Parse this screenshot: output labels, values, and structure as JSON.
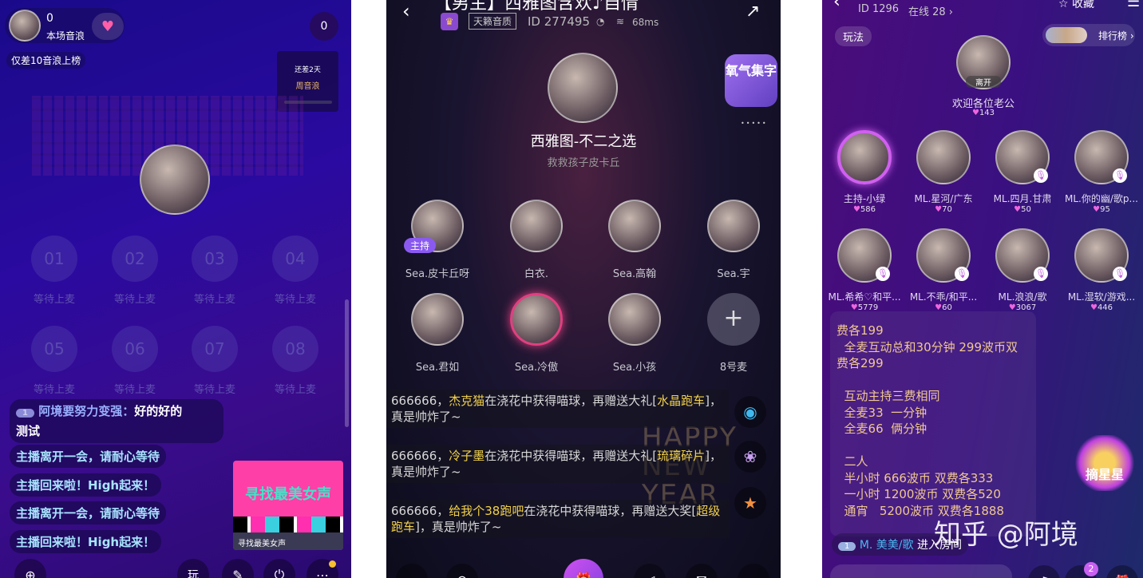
{
  "left": {
    "score": "0",
    "score_label": "本场音浪",
    "rank_hint": "仅差10音浪上榜",
    "right_count": "0",
    "weekly": {
      "days": "还差2天",
      "label": "周音浪"
    },
    "seats": [
      {
        "num": "01",
        "label": "等待上麦"
      },
      {
        "num": "02",
        "label": "等待上麦"
      },
      {
        "num": "03",
        "label": "等待上麦"
      },
      {
        "num": "04",
        "label": "等待上麦"
      },
      {
        "num": "05",
        "label": "等待上麦"
      },
      {
        "num": "06",
        "label": "等待上麦"
      },
      {
        "num": "07",
        "label": "等待上麦"
      },
      {
        "num": "08",
        "label": "等待上麦"
      }
    ],
    "chat": [
      {
        "badge": "1",
        "user": "阿境要努力变强：",
        "text": "好的好的",
        "text2": "测试"
      },
      {
        "text": "主播离开一会，请耐心等待"
      },
      {
        "text": "主播回来啦！High起来！"
      },
      {
        "text": "主播离开一会，请耐心等待"
      },
      {
        "text": "主播回来啦！High起来！"
      }
    ],
    "promo": {
      "banner": "寻找最美女声",
      "caption": "寻找最美女声"
    }
  },
  "middle": {
    "title": "【男主】西雅图含欢♪自情",
    "quality": "天籁音质",
    "room_id": "ID 277495",
    "ping": "68ms",
    "host_name": "西雅图-不二之选",
    "host_sub": "救救孩子皮卡丘",
    "side_badge": "氧气集字",
    "host_tag": "主持",
    "seats": [
      {
        "name": "Sea.皮卡丘呀"
      },
      {
        "name": "白衣."
      },
      {
        "name": "Sea.高翰"
      },
      {
        "name": "Sea.宇"
      },
      {
        "name": "Sea.君如"
      },
      {
        "name": "Sea.冷傲"
      },
      {
        "name": "Sea.小孩"
      },
      {
        "name": "8号麦"
      }
    ],
    "messages": [
      {
        "a": "666666，",
        "b": "杰克猫",
        "c": "在浇花中获得喵球，再赠送大礼[",
        "d": "水晶跑车",
        "e": "]，真是帅炸了~"
      },
      {
        "a": "666666，",
        "b": "冷子墨",
        "c": "在浇花中获得喵球，再赠送大礼[",
        "d": "琉璃碎片",
        "e": "]，真是帅炸了~"
      },
      {
        "a": "666666，",
        "b": "给我个38跑吧",
        "c": "在浇花中获得喵球，再赠送大奖[",
        "d": "超级跑车",
        "e": "]，真是帅炸了~"
      }
    ],
    "bg_text": "HAPPY NEW YEAR"
  },
  "right": {
    "room_id": "ID 1296",
    "online": "在线 28 ›",
    "favorite": "收藏",
    "play_btn": "玩法",
    "rank_btn": "排行榜 ›",
    "host_status": "离开",
    "host_title": "欢迎各位老公",
    "host_hearts": "143",
    "seats": [
      {
        "name": "主持-小绿",
        "hearts": "586"
      },
      {
        "name": "ML.星河/广东",
        "hearts": "70"
      },
      {
        "name": "ML.四月.甘肃",
        "hearts": "50"
      },
      {
        "name": "ML.你的幽/歌p...",
        "hearts": "95"
      },
      {
        "name": "ML.希希♡和平...",
        "hearts": "5779"
      },
      {
        "name": "ML.不乖/和平...",
        "hearts": "60"
      },
      {
        "name": "ML.浪浪/歌",
        "hearts": "3067"
      },
      {
        "name": "ML.湿软/游戏...",
        "hearts": "446"
      }
    ],
    "notice": [
      "费各199",
      "  全麦互动总和30分钟 299波币双",
      "费各299",
      "",
      "  互动主持三费相同",
      "  全麦33  一分钟",
      "  全麦66  俩分钟",
      "",
      "  二人",
      "  半小时 666波币 双费各333",
      "  一小时 1200波币 双费各520",
      "  通宵   5200波币 双费各1888"
    ],
    "enter": {
      "badge": "1",
      "user": "M. 美美/歌",
      "text": " 进入房间"
    },
    "star_badge": "摘星星",
    "msg_count": "2",
    "watermark": "知乎 @阿境"
  }
}
